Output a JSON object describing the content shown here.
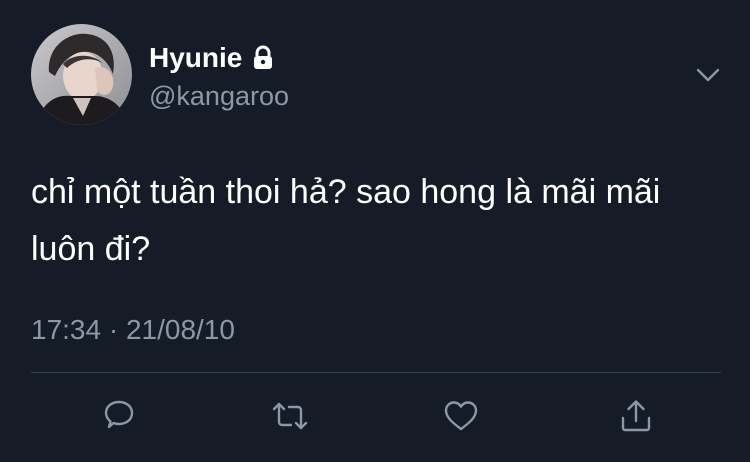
{
  "user": {
    "display_name": "Hyunie",
    "handle": "@kangaroo",
    "avatar_icon": "avatar-photo",
    "lock_icon": "lock-icon"
  },
  "tweet": {
    "text": "chỉ một tuần thoi hả? sao hong là mãi mãi luôn đi?",
    "timestamp": "17:34 · 21/08/10"
  },
  "actions": {
    "reply_icon": "reply-icon",
    "retweet_icon": "retweet-icon",
    "like_icon": "heart-icon",
    "share_icon": "share-icon",
    "more_icon": "chevron-down-icon"
  },
  "colors": {
    "background": "#151c27",
    "primary_text": "#ffffff",
    "secondary_text": "#8b98a5",
    "divider": "#38444d"
  }
}
